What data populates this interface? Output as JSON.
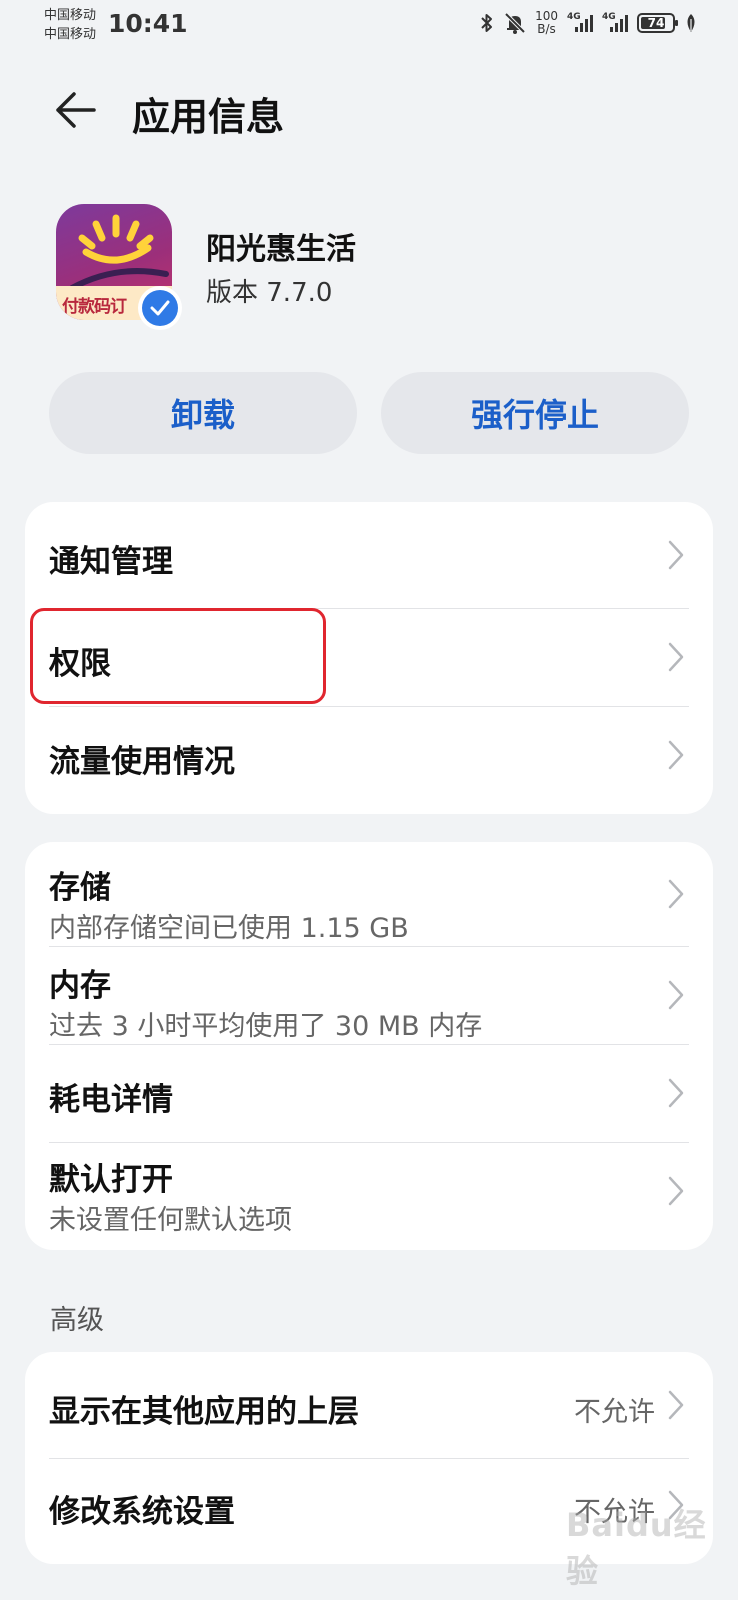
{
  "status_bar": {
    "carrier_1": "中国移动",
    "carrier_2": "中国移动",
    "time": "10:41",
    "net_speed_value": "100",
    "net_speed_unit": "B/s",
    "signal_1_label": "4G",
    "signal_2_label": "4G",
    "battery": "74",
    "icons": [
      "bluetooth-icon",
      "mute-bell-icon",
      "leaf-icon"
    ]
  },
  "header": {
    "title": "应用信息"
  },
  "app": {
    "name": "阳光惠生活",
    "version": "版本 7.7.0",
    "icon_banner_text": "付款码订"
  },
  "actions": {
    "uninstall": "卸载",
    "force_stop": "强行停止"
  },
  "group1": [
    {
      "label": "通知管理"
    },
    {
      "label": "权限"
    },
    {
      "label": "流量使用情况"
    }
  ],
  "group2": [
    {
      "label": "存储",
      "sub": "内部存储空间已使用 1.15 GB"
    },
    {
      "label": "内存",
      "sub": "过去 3 小时平均使用了 30 MB 内存"
    },
    {
      "label": "耗电详情"
    },
    {
      "label": "默认打开",
      "sub": "未设置任何默认选项"
    }
  ],
  "advanced": {
    "title": "高级",
    "items": [
      {
        "label": "显示在其他应用的上层",
        "value": "不允许"
      },
      {
        "label": "修改系统设置",
        "value": "不允许"
      }
    ]
  },
  "watermark": "Baidu经验",
  "colors": {
    "accent": "#1b5fc9",
    "highlight": "#e0262f",
    "background": "#f1f3f5"
  }
}
